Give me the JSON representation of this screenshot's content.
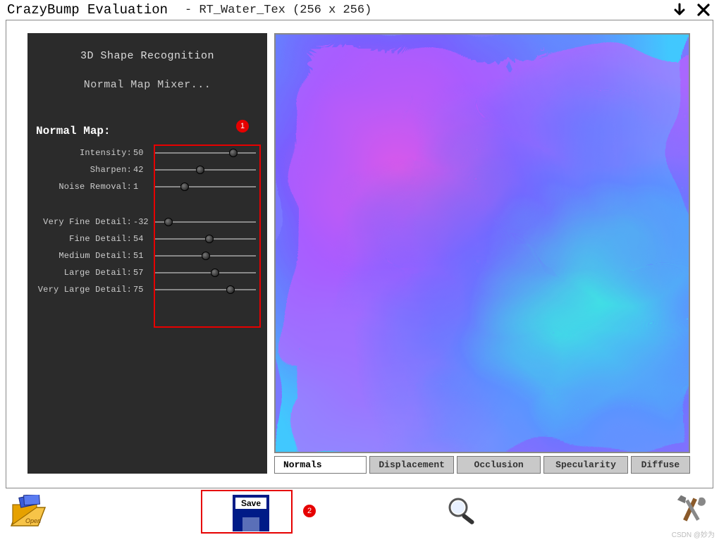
{
  "title": {
    "app": "CrazyBump Evaluation",
    "file": "- RT_Water_Tex (256 x 256)"
  },
  "panel": {
    "link_shape": "3D Shape Recognition",
    "link_mixer": "Normal Map Mixer...",
    "heading": "Normal Map:",
    "group1": [
      {
        "label": "Intensity:",
        "value": 50,
        "min": 0,
        "max": 100,
        "pct": 78
      },
      {
        "label": "Sharpen:",
        "value": 42,
        "min": 0,
        "max": 100,
        "pct": 45
      },
      {
        "label": "Noise Removal:",
        "value": 1,
        "min": 0,
        "max": 10,
        "pct": 30
      }
    ],
    "group2": [
      {
        "label": "Very Fine Detail:",
        "value": -32,
        "min": -100,
        "max": 100,
        "pct": 14
      },
      {
        "label": "Fine Detail:",
        "value": 54,
        "min": 0,
        "max": 100,
        "pct": 54
      },
      {
        "label": "Medium Detail:",
        "value": 51,
        "min": 0,
        "max": 100,
        "pct": 51
      },
      {
        "label": "Large Detail:",
        "value": 57,
        "min": 0,
        "max": 100,
        "pct": 60
      },
      {
        "label": "Very Large Detail:",
        "value": 75,
        "min": 0,
        "max": 100,
        "pct": 75
      }
    ]
  },
  "tabs": [
    {
      "label": "Normals",
      "active": true
    },
    {
      "label": "Displacement",
      "active": false
    },
    {
      "label": "Occlusion",
      "active": false
    },
    {
      "label": "Specularity",
      "active": false
    },
    {
      "label": "Diffuse",
      "active": false
    }
  ],
  "toolbar": {
    "open_label": "Open",
    "save_label": "Save"
  },
  "annotations": {
    "badge1": "1",
    "badge2": "2"
  },
  "watermark": "CSDN @妙为"
}
